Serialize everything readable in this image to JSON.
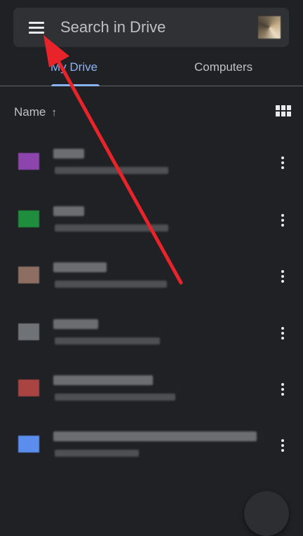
{
  "search": {
    "placeholder": "Search in Drive",
    "icon": "menu-icon"
  },
  "tabs": [
    {
      "label": "My Drive",
      "active": true
    },
    {
      "label": "Computers",
      "active": false
    }
  ],
  "sort": {
    "label": "Name",
    "direction_icon": "arrow-up-icon",
    "view_toggle_icon": "grid-view-icon"
  },
  "files": [
    {
      "icon_color": "#8e44ad"
    },
    {
      "icon_color": "#1e8e3e"
    },
    {
      "icon_color": "#8d6e63"
    },
    {
      "icon_color": "#6f7277"
    },
    {
      "icon_color": "#a94442"
    },
    {
      "icon_color": "#5b8def"
    }
  ],
  "colors": {
    "background": "#202124",
    "accent": "#8ab4f8",
    "annotation_arrow": "#e8232a"
  }
}
